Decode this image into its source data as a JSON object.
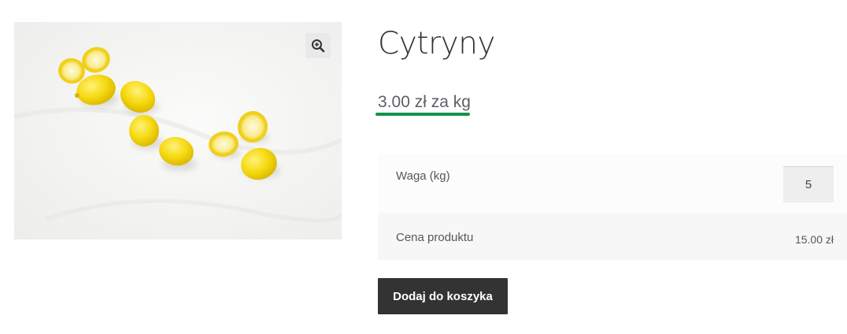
{
  "product": {
    "title": "Cytryny",
    "price": "3.00 zł za kg",
    "image_alt": "lemons"
  },
  "options": {
    "weight_label": "Waga (kg)",
    "weight_value": "5",
    "total_label": "Cena produktu",
    "total_value": "15.00 zł"
  },
  "actions": {
    "add_to_cart_label": "Dodaj do koszyka"
  },
  "colors": {
    "accent_underline": "#13914a",
    "button_bg": "#333333",
    "button_text": "#ffffff"
  },
  "icons": {
    "zoom": "magnifier-plus-icon"
  }
}
